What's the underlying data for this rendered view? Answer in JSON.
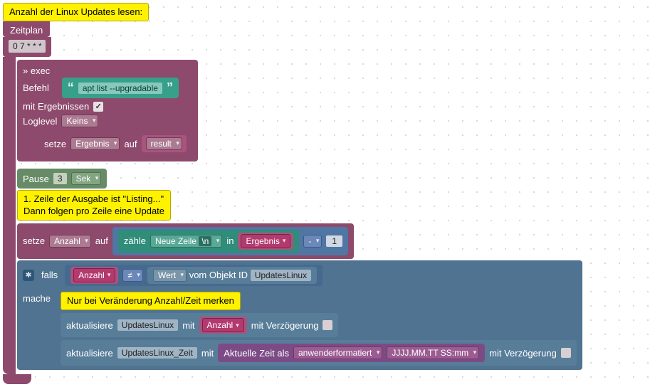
{
  "comment_top": "Anzahl der Linux Updates lesen:",
  "plan_label": "Zeitplan",
  "cron": "0 7 * * *",
  "exec": {
    "title": "» exec",
    "command_label": "Befehl",
    "command": "apt list --upgradable",
    "with_results_label": "mit Ergebnissen",
    "with_results_checked": "✓",
    "loglevel_label": "Loglevel",
    "loglevel_value": "Keins",
    "set_label": "setze",
    "set_var": "Ergebnis",
    "to_label": "auf",
    "result_var": "result"
  },
  "pause": {
    "label": "Pause",
    "value": "3",
    "unit": "Sek"
  },
  "comment_mid_line1": "1. Zeile der Ausgabe ist \"Listing...\"",
  "comment_mid_line2": "Dann folgen pro Zeile eine Update",
  "count_line": {
    "set": "setze",
    "var": "Anzahl",
    "to": "auf",
    "count": "zähle",
    "sep_label": "Neue Zeile",
    "sep_code": "\\n",
    "in": "in",
    "source": "Ergebnis",
    "minus": "-",
    "one": "1"
  },
  "if_block": {
    "if": "falls",
    "do": "mache",
    "left": "Anzahl",
    "op": "≠",
    "right_label": "Wert",
    "from_obj": "vom Objekt ID",
    "obj": "UpdatesLinux"
  },
  "comment_if": "Nur bei Veränderung Anzahl/Zeit merken",
  "update1": {
    "action": "aktualisiere",
    "obj": "UpdatesLinux",
    "with": "mit",
    "value": "Anzahl",
    "delay": "mit Verzögerung"
  },
  "update2": {
    "action": "aktualisiere",
    "obj": "UpdatesLinux_Zeit",
    "with": "mit",
    "time_label": "Aktuelle Zeit als",
    "time_mode": "anwenderformatiert",
    "time_fmt": "JJJJ.MM.TT SS:mm",
    "delay": "mit Verzögerung"
  }
}
